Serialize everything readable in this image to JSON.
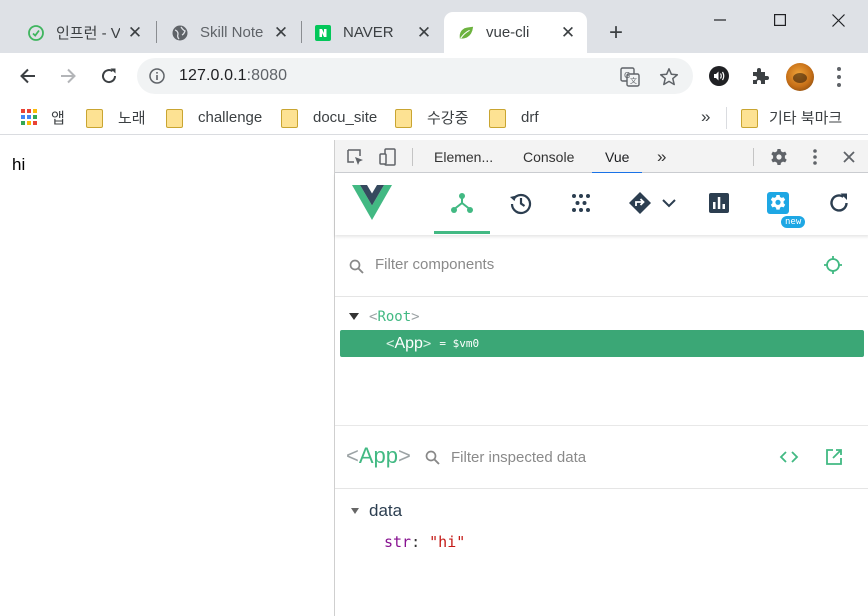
{
  "browser": {
    "tabs": [
      {
        "title": "인프런 - V",
        "favicon": "inflearn-icon"
      },
      {
        "title": "Skill Note",
        "favicon": "globe-icon"
      },
      {
        "title": "NAVER",
        "favicon": "naver-icon"
      },
      {
        "title": "vue-cli",
        "favicon": "spring-leaf-icon",
        "active": true
      }
    ],
    "new_tab_label": "+",
    "url_host": "127.0.0.1",
    "url_port": ":8080",
    "bookmarks": {
      "apps_label": "앱",
      "folders": [
        "노래",
        "challenge",
        "docu_site",
        "수강중",
        "drf"
      ],
      "overflow_label": "»",
      "other_label": "기타 북마크"
    }
  },
  "page": {
    "text": "hi"
  },
  "devtools": {
    "tabs": [
      "Elemen...",
      "Console",
      "Vue"
    ],
    "active_tab": "Vue",
    "more_tabs_label": "»",
    "vue": {
      "new_badge": "new",
      "filter_placeholder": "Filter components",
      "tree": {
        "root_name": "Root",
        "app_name": "App",
        "app_vm": "= $vm0"
      },
      "inspector": {
        "component_name": "App",
        "filter_placeholder": "Filter inspected data",
        "section_label": "data",
        "prop_key": "str",
        "prop_value": "\"hi\""
      }
    }
  },
  "colors": {
    "vue_green": "#42b983",
    "selected_row": "#3ba776",
    "chrome_blue": "#1a73e8",
    "new_badge": "#1ea7e4"
  }
}
